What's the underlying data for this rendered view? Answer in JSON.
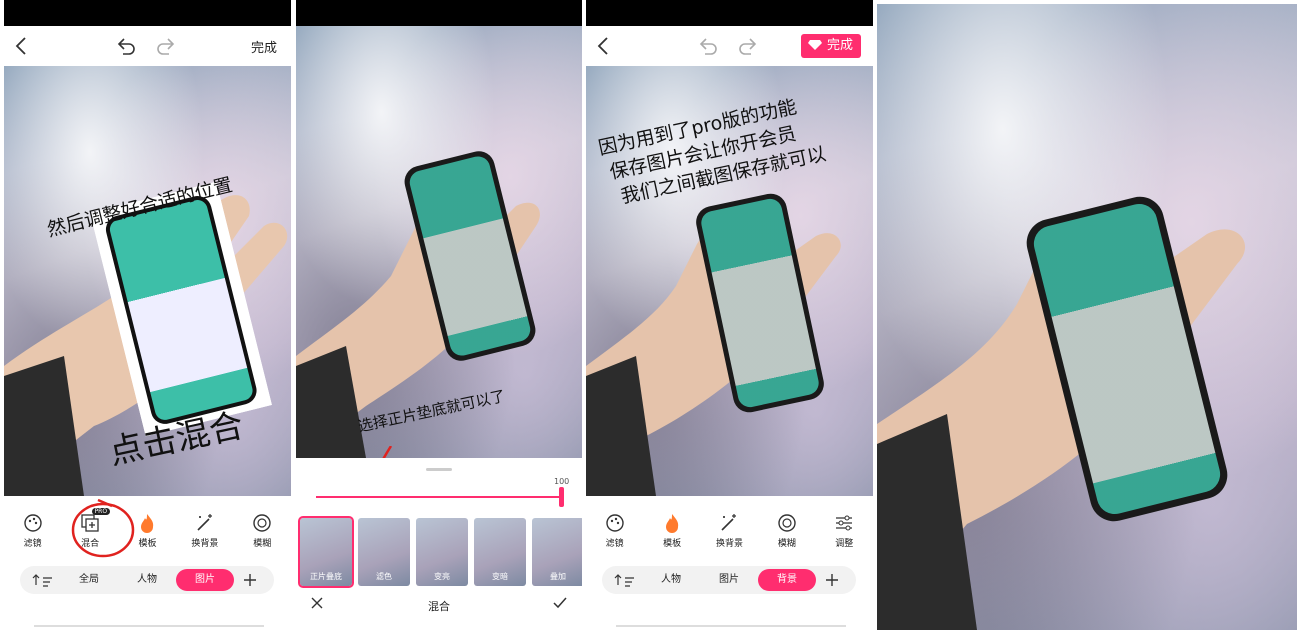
{
  "panel1": {
    "top": {
      "done_label": "完成"
    },
    "annotations": {
      "adjust": "然后调整好合适的位置",
      "click_mix": "点击混合"
    },
    "tools": [
      {
        "label": "滤镜",
        "icon": "palette-icon"
      },
      {
        "label": "混合",
        "icon": "blend-icon",
        "badge": "PRO"
      },
      {
        "label": "模板",
        "icon": "flame-icon"
      },
      {
        "label": "换背景",
        "icon": "magic-wand-icon"
      },
      {
        "label": "模糊",
        "icon": "blur-icon"
      }
    ],
    "segments": [
      "全局",
      "人物",
      "图片"
    ],
    "active_segment": "图片"
  },
  "panel2": {
    "annotation": "选择正片垫底就可以了",
    "slider_value": "100",
    "blend_modes": [
      "正片叠底",
      "滤色",
      "变亮",
      "变暗",
      "叠加"
    ],
    "selected_mode": "正片叠底",
    "sheet_title": "混合"
  },
  "panel3": {
    "top": {
      "done_label": "完成"
    },
    "annotation_lines": [
      "因为用到了pro版的功能",
      "保存图片会让你开会员",
      "我们之间截图保存就可以"
    ],
    "tools": [
      {
        "label": "滤镜",
        "icon": "palette-icon"
      },
      {
        "label": "模板",
        "icon": "flame-icon"
      },
      {
        "label": "换背景",
        "icon": "magic-wand-icon"
      },
      {
        "label": "模糊",
        "icon": "blur-icon"
      },
      {
        "label": "调整",
        "icon": "sliders-icon"
      }
    ],
    "segments": [
      "人物",
      "图片",
      "背景"
    ],
    "active_segment": "背景"
  },
  "colors": {
    "accent": "#ff2d6f",
    "app_green": "#3dbfa8"
  }
}
